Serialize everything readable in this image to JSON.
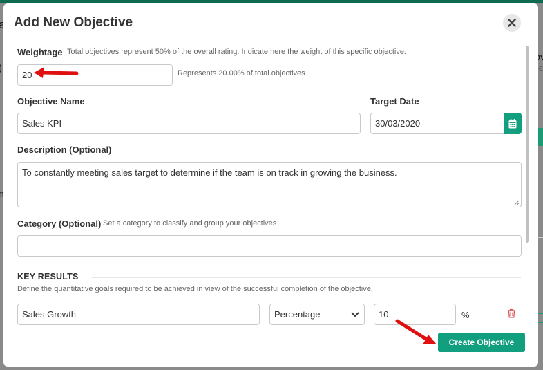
{
  "background": {
    "fragment_a": "a",
    "fragment_paren": ")",
    "fragment_n": "n",
    "fragment_ov": "ov",
    "fragment_e": "e"
  },
  "modal": {
    "title": "Add New Objective",
    "close_icon": "close-icon"
  },
  "form": {
    "weightage": {
      "label": "Weightage",
      "hint": "Total objectives represent 50% of the overall rating. Indicate here the weight of this specific objective.",
      "value": "20",
      "note": "Represents 20.00% of total objectives"
    },
    "objective_name": {
      "label": "Objective Name",
      "value": "Sales KPI"
    },
    "target_date": {
      "label": "Target Date",
      "value": "30/03/2020",
      "icon": "calendar-icon"
    },
    "description": {
      "label": "Description (Optional)",
      "value": "To constantly meeting sales target to determine if the team is on track in growing the business."
    },
    "category": {
      "label": "Category (Optional)",
      "hint": "Set a category to classify and group your objectives",
      "value": ""
    }
  },
  "key_results": {
    "title": "KEY RESULTS",
    "description": "Define the quantitative goals required to be achieved in view of the successful completion of the objective.",
    "rows": [
      {
        "name": "Sales Growth",
        "type": "Percentage",
        "target": "10",
        "unit": "%"
      }
    ]
  },
  "actions": {
    "create_label": "Create Objective"
  },
  "colors": {
    "accent": "#119f7f",
    "annotation_arrow": "#e01010",
    "delete_icon": "#d9534f"
  }
}
